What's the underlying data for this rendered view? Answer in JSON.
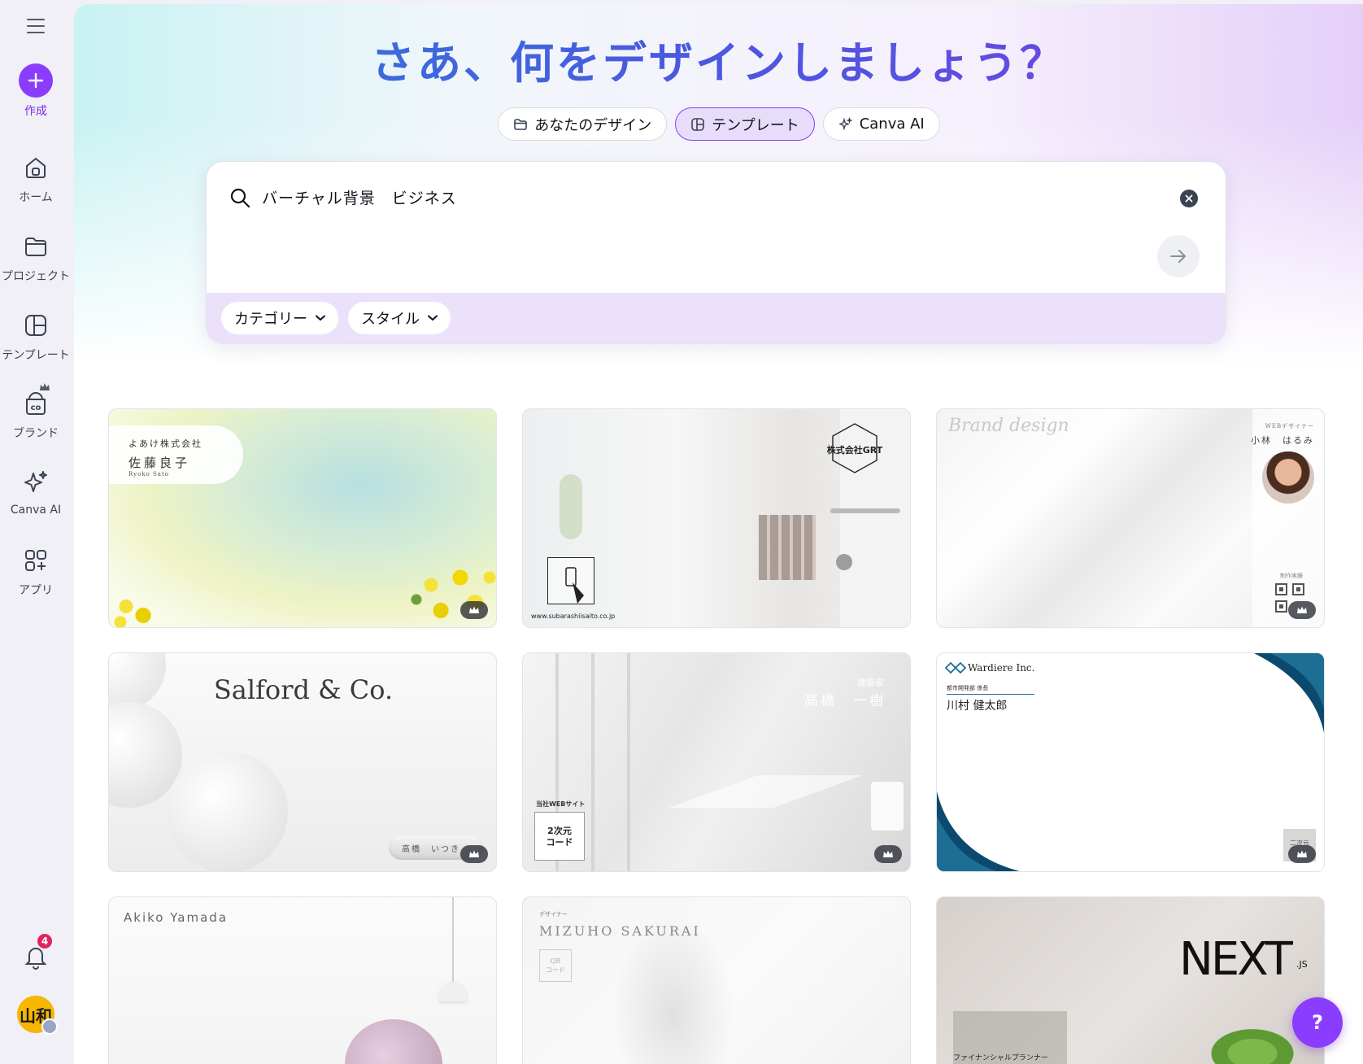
{
  "sidebar": {
    "create": "作成",
    "items": [
      {
        "label": "ホーム",
        "icon": "home-icon"
      },
      {
        "label": "プロジェクト",
        "icon": "folder-icon"
      },
      {
        "label": "テンプレート",
        "icon": "template-icon"
      },
      {
        "label": "ブランド",
        "icon": "brand-icon"
      },
      {
        "label": "Canva AI",
        "icon": "sparkle-icon"
      },
      {
        "label": "アプリ",
        "icon": "apps-icon"
      }
    ],
    "notifications_count": "4",
    "avatar_text": "山和"
  },
  "main": {
    "headline": "さあ、何をデザインしましょう？",
    "tabs": [
      {
        "label": "あなたのデザイン",
        "icon": "folder-icon",
        "active": false
      },
      {
        "label": "テンプレート",
        "icon": "template-icon",
        "active": true
      },
      {
        "label": "Canva AI",
        "icon": "sparkle-icon",
        "active": false
      }
    ],
    "search": {
      "value": "バーチャル背景　ビジネス"
    },
    "filters": [
      "カテゴリー",
      "スタイル"
    ],
    "help": "?"
  },
  "templates": [
    {
      "company": "よあけ株式会社",
      "name": "佐藤良子",
      "roman": "Ryoko Sato",
      "premium": true
    },
    {
      "company": "株式会社GRT",
      "url": "www.subarashiisaito.co.jp",
      "premium": false
    },
    {
      "brand": "Brand design",
      "title": "WEBデザイナー",
      "name": "小林　はるみ",
      "qr_label": "制作実績",
      "premium": true
    },
    {
      "company": "Salford & Co.",
      "name": "高橋　いつき",
      "premium": true
    },
    {
      "title": "建築家",
      "name": "高橋　一樹",
      "web_label": "当社WEBサイト",
      "qr": "2次元\nコード",
      "premium": true
    },
    {
      "company": "Wardiere Inc.",
      "dept": "都市開発部 係長",
      "name": "川村 健太郎",
      "qr": "二次元",
      "premium": true
    },
    {
      "name": "Akiko Yamada"
    },
    {
      "title": "デザイナー",
      "name": "MIZUHO SAKURAI",
      "qr": "QR\nコード"
    },
    {
      "brand": "NEXT",
      "brand_suffix": ".JS",
      "title": "ファイナンシャルプランナー"
    }
  ],
  "colors": {
    "accent": "#8b3dff",
    "tab_active_bg": "#e8dcfb",
    "filter_bar": "#ebe1fb",
    "notification_badge": "#e0245e",
    "wardiere_navy": "#0b4a6e"
  }
}
